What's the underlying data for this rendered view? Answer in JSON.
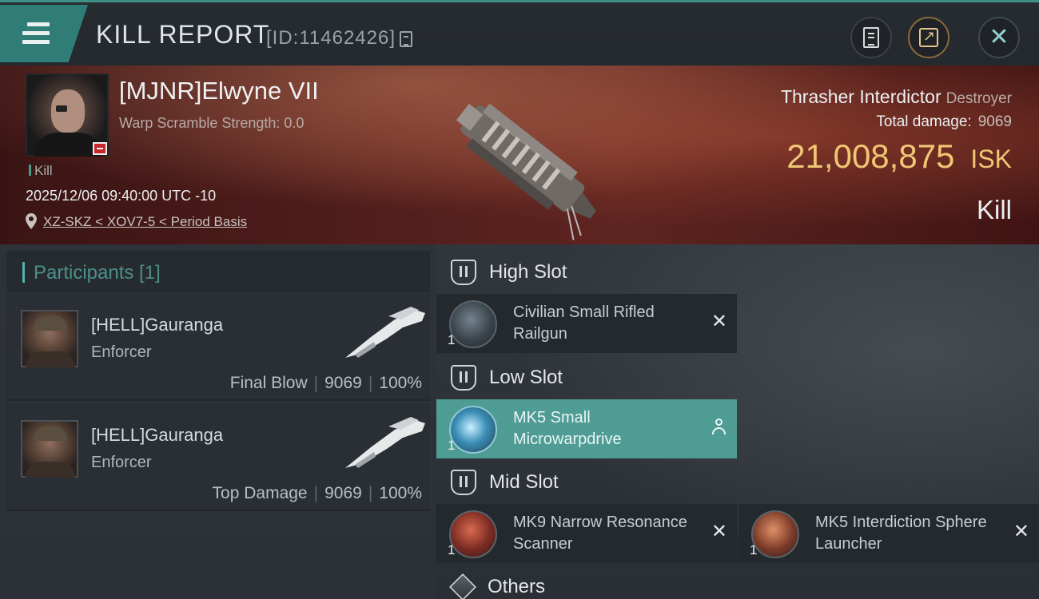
{
  "header": {
    "title": "KILL REPORT",
    "report_id": "[ID:11462426]"
  },
  "victim": {
    "name": "[MJNR]Elwyne VII",
    "warp_scramble": "Warp Scramble Strength: 0.0",
    "tag": "Kill",
    "timestamp": "2025/12/06 09:40:00 UTC -10",
    "location": "XZ-SKZ < XOV7-5 < Period Basis",
    "ship_name": "Thrasher Interdictor",
    "ship_class": "Destroyer",
    "total_damage_label": "Total damage:",
    "total_damage": "9069",
    "isk_value": "21,008,875",
    "isk_unit": "ISK",
    "kill_type": "Kill"
  },
  "participants": {
    "header": "Participants [1]",
    "items": [
      {
        "name": "[HELL]Gauranga",
        "corp": "Enforcer",
        "label": "Final Blow",
        "damage": "9069",
        "percent": "100%"
      },
      {
        "name": "[HELL]Gauranga",
        "corp": "Enforcer",
        "label": "Top Damage",
        "damage": "9069",
        "percent": "100%"
      }
    ]
  },
  "fitting": {
    "high_slot": {
      "title": "High Slot",
      "modules": [
        {
          "name": "Civilian Small Rifled Railgun",
          "qty": "1",
          "status": "✕"
        }
      ]
    },
    "low_slot": {
      "title": "Low Slot",
      "modules": [
        {
          "name": "MK5 Small Microwarpdrive",
          "qty": "1",
          "status_icon": "person-icon"
        }
      ]
    },
    "mid_slot": {
      "title": "Mid Slot",
      "modules": [
        {
          "name": "MK9 Narrow Resonance Scanner",
          "qty": "1",
          "status": "✕"
        },
        {
          "name": "MK5 Interdiction Sphere Launcher",
          "qty": "1",
          "status": "✕"
        }
      ]
    },
    "others": {
      "title": "Others"
    }
  },
  "colors": {
    "accent_teal": "#4f9c95",
    "isk_gold": "#f0c675",
    "hero_red": "#5e2420"
  }
}
